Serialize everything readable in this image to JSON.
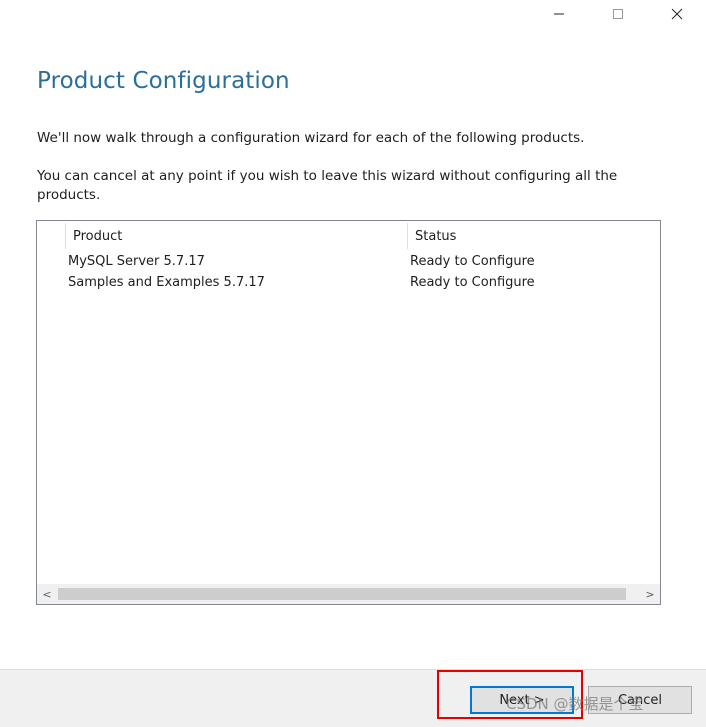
{
  "window": {
    "controls": [
      {
        "name": "minimize-icon",
        "glyph": "—"
      },
      {
        "name": "maximize-icon",
        "glyph": "☐"
      },
      {
        "name": "close-icon",
        "glyph": "✕"
      }
    ]
  },
  "page": {
    "title": "Product Configuration",
    "intro": "We'll now walk through a configuration wizard for each of the following products.",
    "cancel_note": "You can cancel at any point if you wish to leave this wizard without configuring all the products."
  },
  "table": {
    "columns": [
      "Product",
      "Status"
    ],
    "rows": [
      {
        "product": "MySQL Server 5.7.17",
        "status": "Ready to Configure"
      },
      {
        "product": "Samples and Examples 5.7.17",
        "status": "Ready to Configure"
      }
    ],
    "scroll_left": "<",
    "scroll_right": ">"
  },
  "footer": {
    "next_label": "Next >",
    "cancel_label": "Cancel"
  },
  "watermark": "CSDN @数据是个宝",
  "colors": {
    "title": "#2a6e9a",
    "highlight": "#e60000",
    "focus": "#0078d7"
  }
}
